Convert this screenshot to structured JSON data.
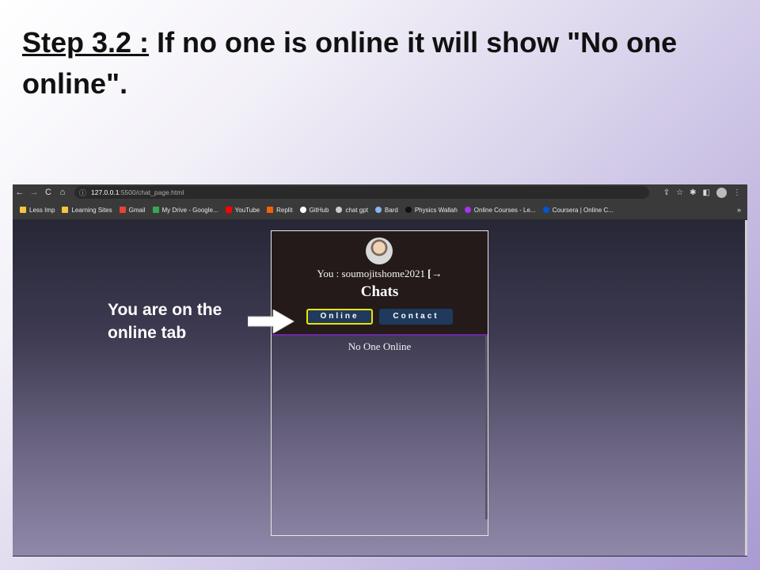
{
  "slide": {
    "step_label": "Step 3.2 :",
    "title_rest": " If no one is online it will show \"No one online\"."
  },
  "browser": {
    "back_icon": "←",
    "forward_icon": "→",
    "reload_icon": "C",
    "home_icon": "⌂",
    "info_icon": "ⓘ",
    "url_host": "127.0.0.1",
    "url_path": ":5500/chat_page.html",
    "share_icon": "⇪",
    "star_icon": "☆",
    "extensions_icon": "✱",
    "sidepanel_icon": "◧",
    "menu_icon": "⋮",
    "bookmarks_more": "»",
    "bookmarks": [
      {
        "label": "Less Imp",
        "color": "#f4c542"
      },
      {
        "label": "Learning Sites",
        "color": "#f4c542"
      },
      {
        "label": "Gmail",
        "color": "#ea4335"
      },
      {
        "label": "My Drive - Google...",
        "color": "#34a853"
      },
      {
        "label": "YouTube",
        "color": "#ff0000"
      },
      {
        "label": "Replit",
        "color": "#f26207"
      },
      {
        "label": "GitHub",
        "color": "#ffffff"
      },
      {
        "label": "chat gpt",
        "color": "#cccccc"
      },
      {
        "label": "Bard",
        "color": "#8ab4f8"
      },
      {
        "label": "Physics Wallah",
        "color": "#111111"
      },
      {
        "label": "Online Courses - Le...",
        "color": "#a435f0"
      },
      {
        "label": "Coursera | Online C...",
        "color": "#0056d2"
      }
    ]
  },
  "app": {
    "you_text": "You : soumojitshome2021",
    "logout_icon": "[→",
    "title": "Chats",
    "tab_online": "Online",
    "tab_contact": "Contact",
    "empty_message": "No One Online"
  },
  "annotation": {
    "callout": "You are on the online tab"
  },
  "colors": {
    "header_bg": "#241a1a",
    "tab_bg": "#1f3a5c",
    "active_tab_border": "#e6e600",
    "divider": "#6a2aa0"
  }
}
